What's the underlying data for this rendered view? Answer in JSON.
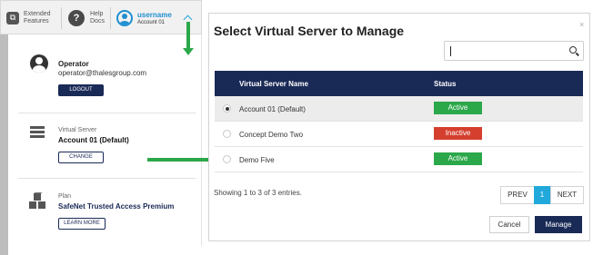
{
  "top_bar": {
    "extended_features": "Extended\nFeatures",
    "help_docs": "Help\nDocs",
    "username": "username",
    "account": "Account 01"
  },
  "profile": {
    "role": "Operator",
    "email": "operator@thalesgroup.com",
    "logout_label": "LOGOUT"
  },
  "virtual_server": {
    "label": "Virtual Server",
    "name": "Account 01 (Default)",
    "change_label": "CHANGE"
  },
  "plan": {
    "label": "Plan",
    "name": "SafeNet Trusted Access Premium",
    "learn_more_label": "LEARN MORE"
  },
  "modal": {
    "title": "Select Virtual Server to Manage",
    "close": "×",
    "search_value": "",
    "columns": [
      "Virtual Server Name",
      "Status"
    ],
    "rows": [
      {
        "name": "Account 01 (Default)",
        "status": "Active",
        "selected": true
      },
      {
        "name": "Concept Demo Two",
        "status": "Inactive",
        "selected": false
      },
      {
        "name": "Demo Five",
        "status": "Active",
        "selected": false
      }
    ],
    "entries_text": "Showing 1 to 3 of 3 entries.",
    "pagination": {
      "prev": "PREV",
      "page": "1",
      "next": "NEXT"
    },
    "cancel_label": "Cancel",
    "manage_label": "Manage"
  },
  "colors": {
    "navy": "#1a2a57",
    "active_green": "#2ba84a",
    "inactive_red": "#d43f2e",
    "accent_blue": "#1f8fd1",
    "annotation_arrow": "#2aa84a"
  },
  "icons": [
    "extended-features-icon",
    "help-icon",
    "user-avatar-icon",
    "chevron-up-icon",
    "operator-avatar-icon",
    "server-icon",
    "cubes-icon",
    "search-icon",
    "close-icon",
    "radio-button"
  ]
}
